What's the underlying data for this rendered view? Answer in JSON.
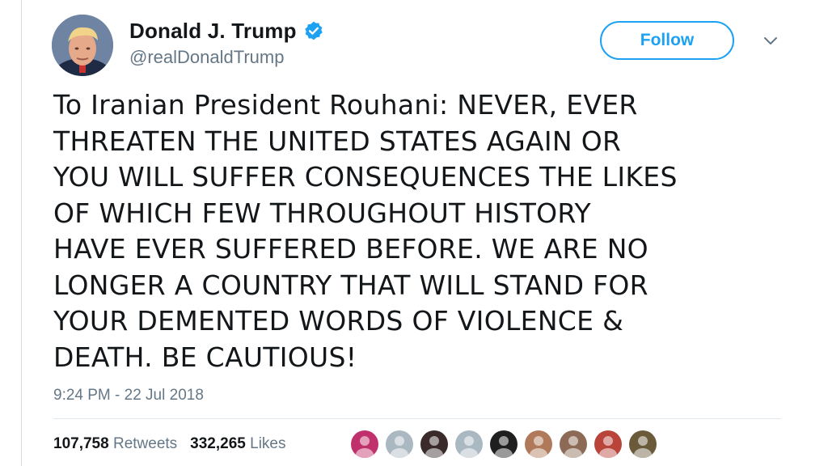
{
  "author": {
    "display_name": "Donald J. Trump",
    "handle": "@realDonaldTrump",
    "verified": true,
    "avatar_icon": "profile-photo"
  },
  "actions": {
    "follow_label": "Follow",
    "more_icon": "chevron-down-icon"
  },
  "tweet": {
    "text": "To Iranian President Rouhani: NEVER, EVER\nTHREATEN THE UNITED STATES AGAIN OR\nYOU WILL SUFFER CONSEQUENCES THE LIKES\nOF WHICH FEW THROUGHOUT HISTORY\nHAVE EVER SUFFERED BEFORE. WE ARE NO\nLONGER A COUNTRY THAT WILL STAND FOR\nYOUR DEMENTED WORDS OF VIOLENCE &\nDEATH. BE CAUTIOUS!",
    "timestamp": "9:24 PM - 22 Jul 2018"
  },
  "stats": {
    "retweets_count": "107,758",
    "retweets_label": "Retweets",
    "likes_count": "332,265",
    "likes_label": "Likes"
  },
  "likers": [
    {
      "name": "liker-avatar-1",
      "color": "#c0306a"
    },
    {
      "name": "liker-avatar-2",
      "color": "#aab8c2"
    },
    {
      "name": "liker-avatar-3",
      "color": "#3a2a2a"
    },
    {
      "name": "liker-avatar-4",
      "color": "#aab8c2"
    },
    {
      "name": "liker-avatar-5",
      "color": "#1f1f1f"
    },
    {
      "name": "liker-avatar-6",
      "color": "#b07a5a"
    },
    {
      "name": "liker-avatar-7",
      "color": "#8c6a55"
    },
    {
      "name": "liker-avatar-8",
      "color": "#b8443a"
    },
    {
      "name": "liker-avatar-9",
      "color": "#6a5a3a"
    }
  ],
  "colors": {
    "accent": "#1da1f2",
    "text": "#14171a",
    "muted": "#657786"
  }
}
